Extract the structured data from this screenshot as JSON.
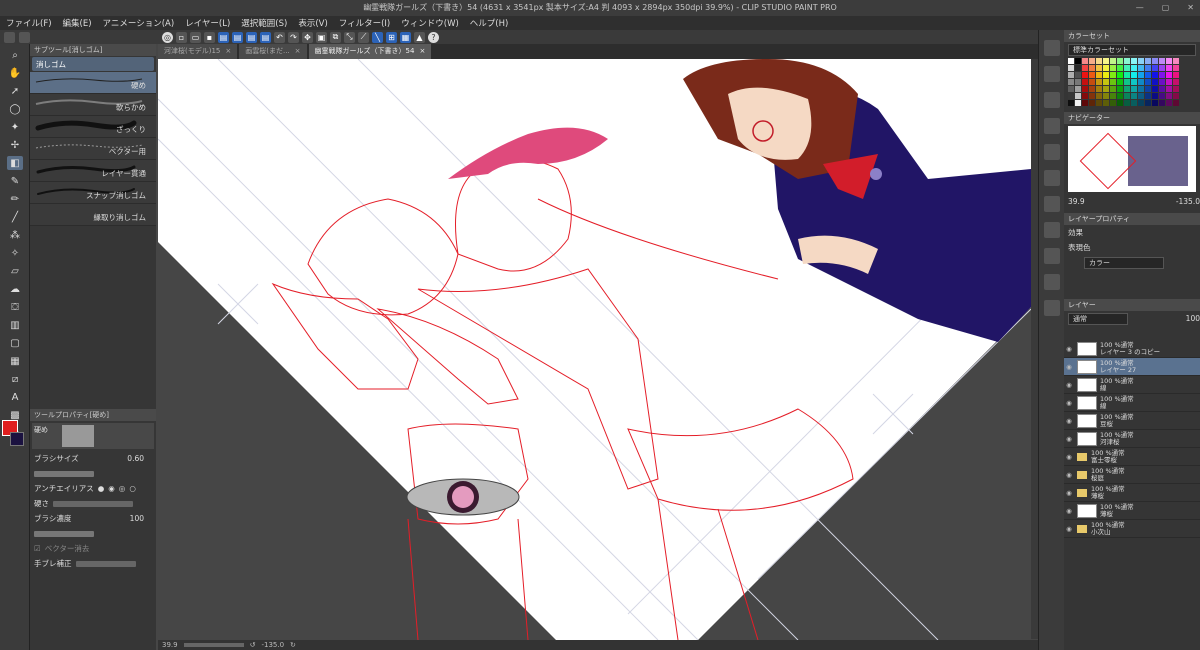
{
  "title": "幽霊戦隊ガールズ（下書き）54 (4631 x 3541px 製本サイズ:A4 判 4093 x 2894px 350dpi 39.9%) - CLIP STUDIO PAINT PRO",
  "menu": [
    "ファイル(F)",
    "編集(E)",
    "アニメーション(A)",
    "レイヤー(L)",
    "選択範囲(S)",
    "表示(V)",
    "フィルター(I)",
    "ウィンドウ(W)",
    "ヘルプ(H)"
  ],
  "subtool": {
    "panel_title": "サブツール[消しゴム]",
    "group": "消しゴム",
    "items": [
      "硬め",
      "軟らかめ",
      "ざっくり",
      "ベクター用",
      "レイヤー貫通",
      "スナップ消しゴム",
      "縁取り消しゴム"
    ]
  },
  "toolprop": {
    "panel_title": "ツールプロパティ[硬め]",
    "preview_label": "硬め",
    "brush_size_label": "ブラシサイズ",
    "brush_size_value": "0.60",
    "antialias_label": "アンチエイリアス",
    "hardness_label": "硬さ",
    "density_label": "ブラシ濃度",
    "density_value": "100",
    "vector_erase_label": "ベクター消去",
    "stabilize_label": "手ブレ補正"
  },
  "doc_tabs": [
    "河津桜(モデル)15",
    "画雲桜(まだ...",
    "幽霊戦隊ガールズ（下書き）54"
  ],
  "status": {
    "zoom": "39.9",
    "angle": "-135.0"
  },
  "colorset": {
    "panel_title": "カラーセット",
    "current": "標準カラーセット"
  },
  "navigator": {
    "panel_title": "ナビゲーター",
    "zoom": "39.9",
    "angle": "-135.0"
  },
  "layer_property": {
    "panel_title": "レイヤープロパティ",
    "effect_label": "効果",
    "expression_label": "表現色",
    "expression_value": "カラー"
  },
  "layers": {
    "panel_title": "レイヤー",
    "blend": "通常",
    "opacity": "100",
    "items": [
      {
        "line1": "100 %通常",
        "line2": "レイヤー 3 のコピー"
      },
      {
        "line1": "100 %通常",
        "line2": "レイヤー 27"
      },
      {
        "line1": "100 %通常",
        "line2": "線"
      },
      {
        "line1": "100 %通常",
        "line2": "線"
      },
      {
        "line1": "100 %通常",
        "line2": "豆桜"
      },
      {
        "line1": "100 %通常",
        "line2": "河津桜"
      },
      {
        "line1": "100 %通常",
        "line2": "富士零桜"
      },
      {
        "line1": "100 %通常",
        "line2": "桜庭"
      },
      {
        "line1": "100 %通常",
        "line2": "薄桜"
      },
      {
        "line1": "100 %通常",
        "line2": "薄桜"
      },
      {
        "line1": "100 %通常",
        "line2": "小次山"
      }
    ]
  },
  "accent": "#5a7290"
}
